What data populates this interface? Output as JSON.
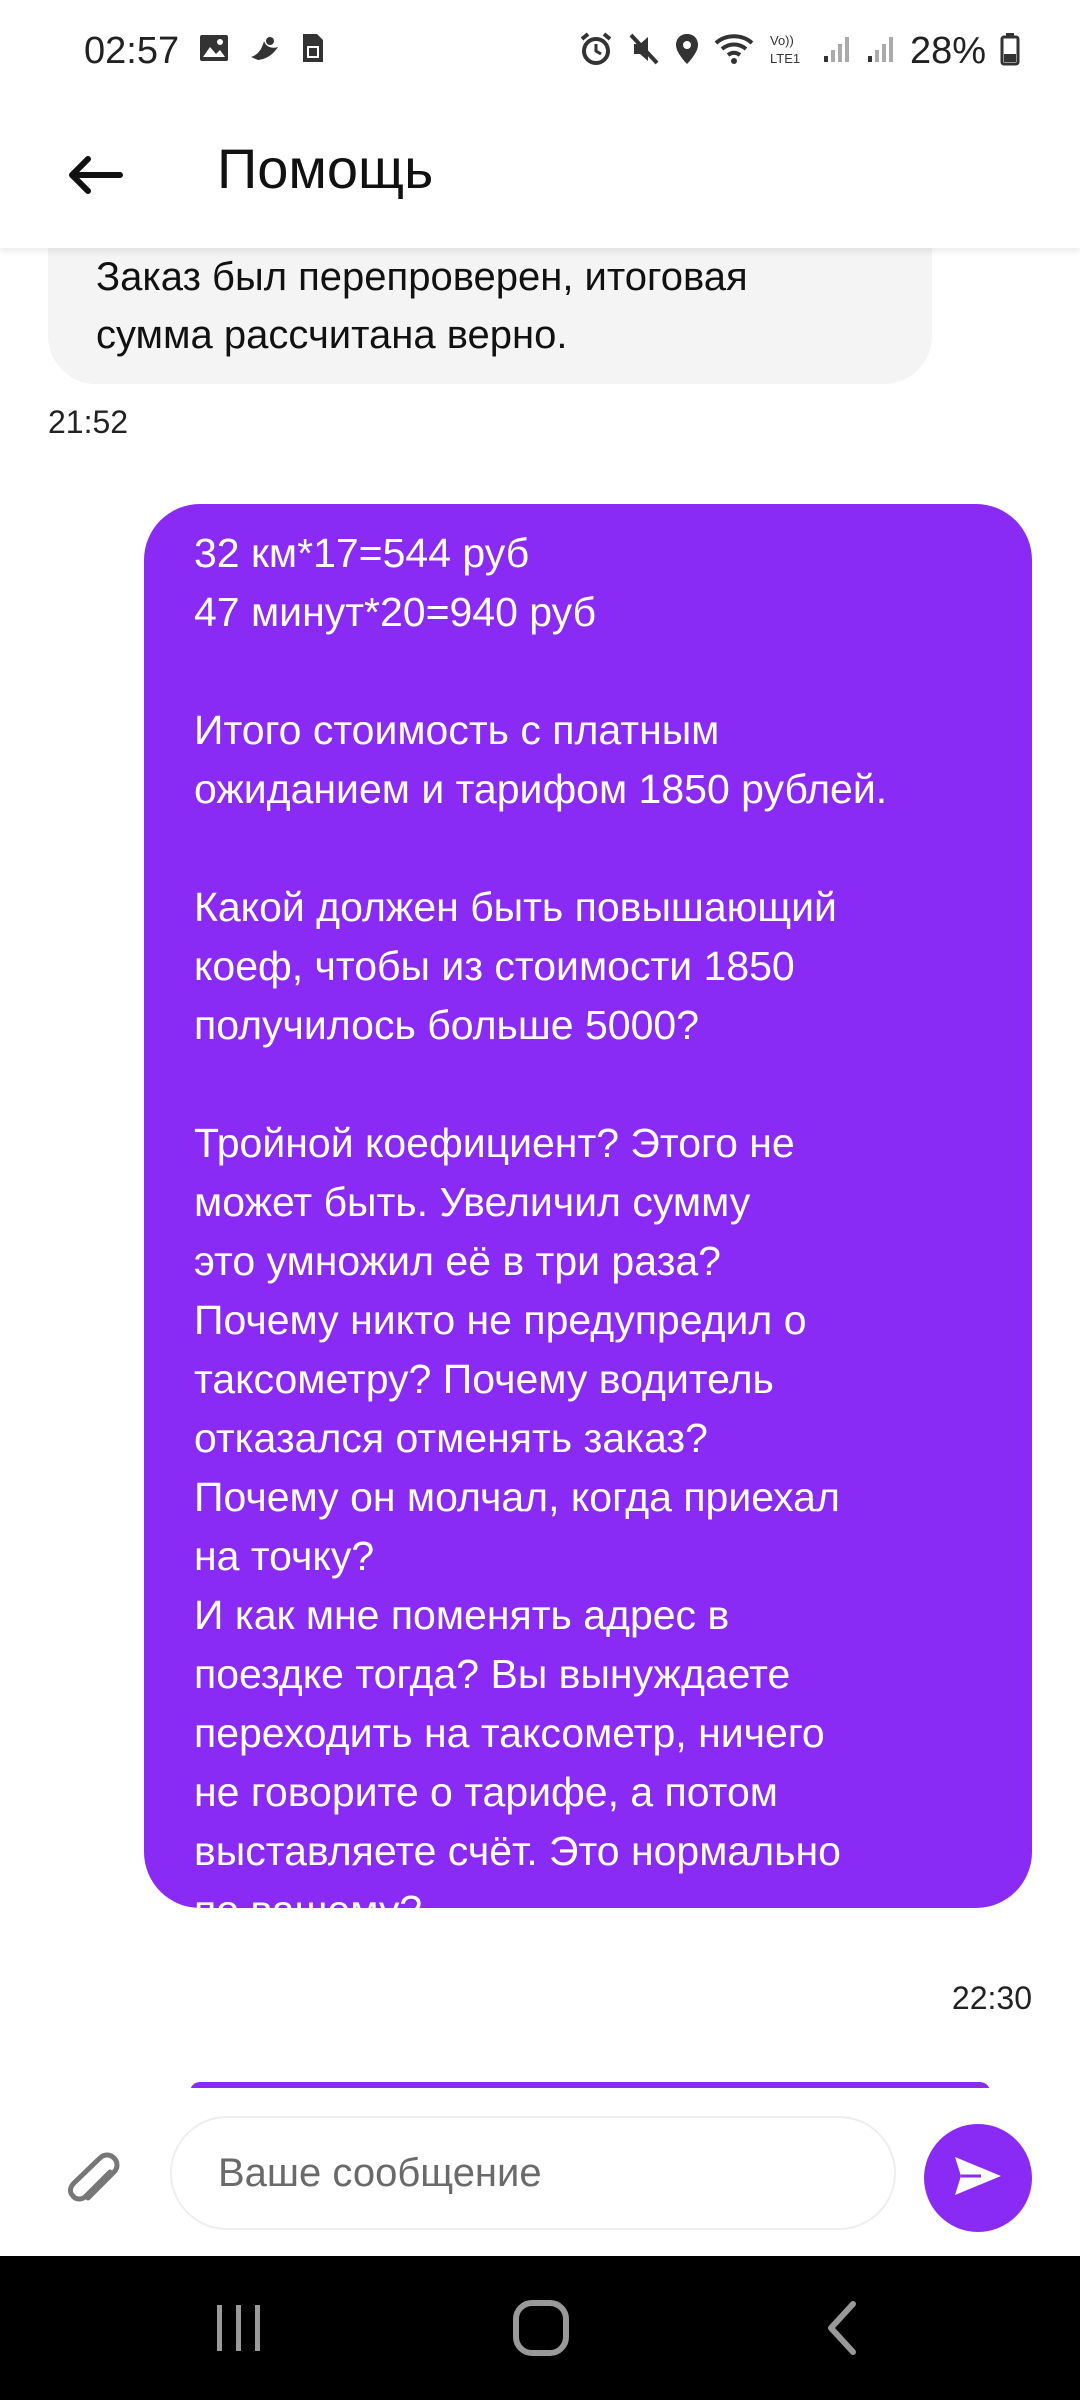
{
  "status_bar": {
    "time": "02:57",
    "battery": "28%",
    "icons_left": [
      "gallery-icon",
      "bird-icon",
      "sim-card-icon"
    ],
    "icons_right": [
      "alarm-icon",
      "mute-icon",
      "location-icon",
      "wifi-icon",
      "volte-icon",
      "signal-icon",
      "signal-icon",
      "battery-icon"
    ]
  },
  "header": {
    "title": "Помощь"
  },
  "chat": {
    "incoming": {
      "text": "Заказ был перепроверен, итоговая\nсумма рассчитана верно.",
      "time": "21:52"
    },
    "outgoing": {
      "text": "32 км*17=544 руб\n47 минут*20=940 руб\n\nИтого стоимость с платным\nожиданием и тарифом 1850 рублей.\n\nКакой должен быть повышающий\nкоеф, чтобы из стоимости 1850\nполучилось больше 5000?\n\nТройной коефициент? Этого не\nможет быть. Увеличил сумму\nэто умножил её в три раза?\nПочему никто не предупредил о\nтаксометру? Почему водитель\nотказался отменять заказ?\nПочему он молчал, когда приехал\nна точку?\nИ как мне поменять адрес в\nпоездке тогда? Вы вынуждаете\nпереходить на таксометр, ничего\nне говорите о тарифе, а потом\nвыставляете счёт. Это нормально\nпо вашему?",
      "time": "22:30"
    }
  },
  "composer": {
    "placeholder": "Ваше сообщение"
  },
  "colors": {
    "accent": "#8a2bf5",
    "incoming_bubble": "#f4f4f5"
  }
}
